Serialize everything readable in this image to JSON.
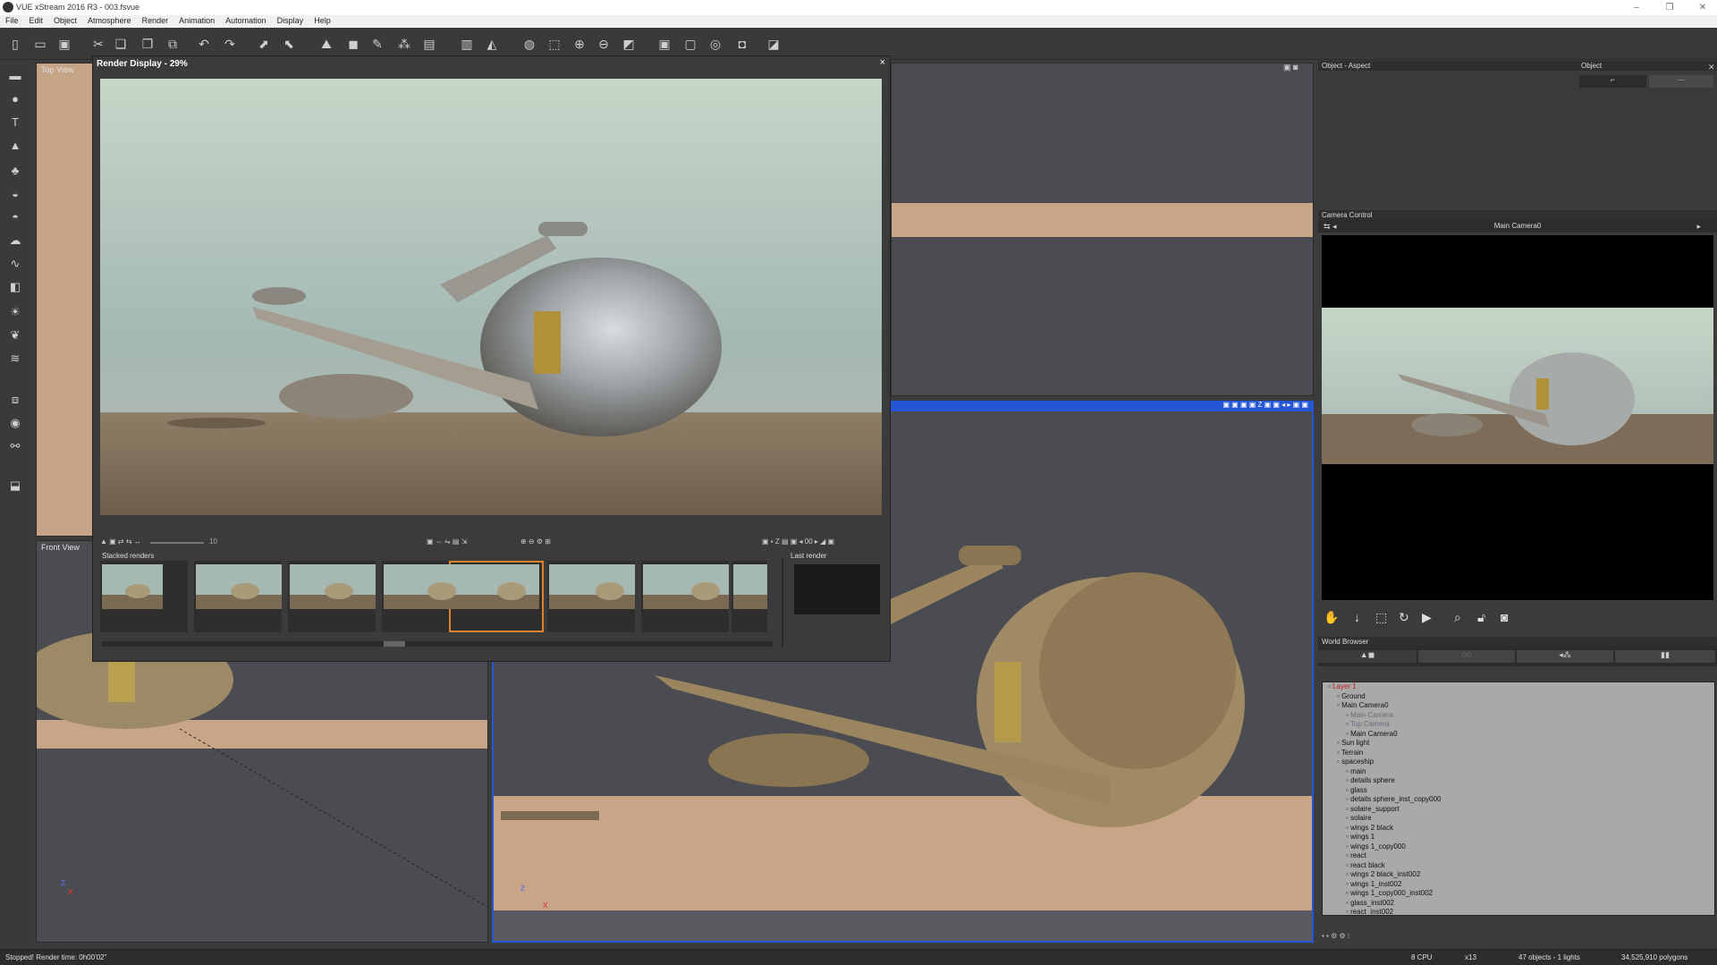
{
  "window": {
    "title": "VUE xStream 2016 R3 - 003.fsvue"
  },
  "menu": [
    "File",
    "Edit",
    "Object",
    "Atmosphere",
    "Render",
    "Animation",
    "Automation",
    "Display",
    "Help"
  ],
  "viewports": {
    "top_view": "Top View",
    "front_view": "Front View"
  },
  "render_display": {
    "title": "Render Display - 29%",
    "close": "×",
    "zoom_value": "10",
    "stacked_renders_label": "Stacked renders",
    "last_render_label": "Last render"
  },
  "right_panels": {
    "object_aspect": "Object - Aspect",
    "object": "Object",
    "camera_control": "Camera Control",
    "camera_name": "Main Camera0",
    "world_browser": "World Browser"
  },
  "world_tree": [
    {
      "label": "Layer 1",
      "indent": 0,
      "style": "red"
    },
    {
      "label": "Ground",
      "indent": 1,
      "style": "normal"
    },
    {
      "label": "Main Camera0",
      "indent": 1,
      "style": "normal"
    },
    {
      "label": "Main Camera",
      "indent": 2,
      "style": "dim"
    },
    {
      "label": "Top Camera",
      "indent": 2,
      "style": "dim"
    },
    {
      "label": "Main Camera0",
      "indent": 2,
      "style": "normal"
    },
    {
      "label": "Sun light",
      "indent": 1,
      "style": "normal"
    },
    {
      "label": "Terrain",
      "indent": 1,
      "style": "normal"
    },
    {
      "label": "spaceship",
      "indent": 1,
      "style": "normal"
    },
    {
      "label": "main",
      "indent": 2,
      "style": "normal"
    },
    {
      "label": "details sphere",
      "indent": 2,
      "style": "normal"
    },
    {
      "label": "glass",
      "indent": 2,
      "style": "normal"
    },
    {
      "label": "details sphere_inst_copy000",
      "indent": 2,
      "style": "normal"
    },
    {
      "label": "solaire_support",
      "indent": 2,
      "style": "normal"
    },
    {
      "label": "solaire",
      "indent": 2,
      "style": "normal"
    },
    {
      "label": "wings 2 black",
      "indent": 2,
      "style": "normal"
    },
    {
      "label": "wings 1",
      "indent": 2,
      "style": "normal"
    },
    {
      "label": "wings 1_copy000",
      "indent": 2,
      "style": "normal"
    },
    {
      "label": "react",
      "indent": 2,
      "style": "normal"
    },
    {
      "label": "react black",
      "indent": 2,
      "style": "normal"
    },
    {
      "label": "wings 2 black_inst002",
      "indent": 2,
      "style": "normal"
    },
    {
      "label": "wings 1_inst002",
      "indent": 2,
      "style": "normal"
    },
    {
      "label": "wings 1_copy000_inst002",
      "indent": 2,
      "style": "normal"
    },
    {
      "label": "glass_inst002",
      "indent": 2,
      "style": "normal"
    },
    {
      "label": "react_inst002",
      "indent": 2,
      "style": "normal"
    }
  ],
  "status": {
    "message": "Stopped! Render time: 0h00'02\"",
    "cpu": "8 CPU",
    "multiplier": "x13",
    "objects": "47 objects - 1 lights",
    "polygons": "34,525,910 polygons"
  },
  "colors": {
    "floor": "#c8a587",
    "viewport_bg": "#4a4c52",
    "selection_orange": "#e0822e",
    "active_blue": "#2456d6"
  }
}
